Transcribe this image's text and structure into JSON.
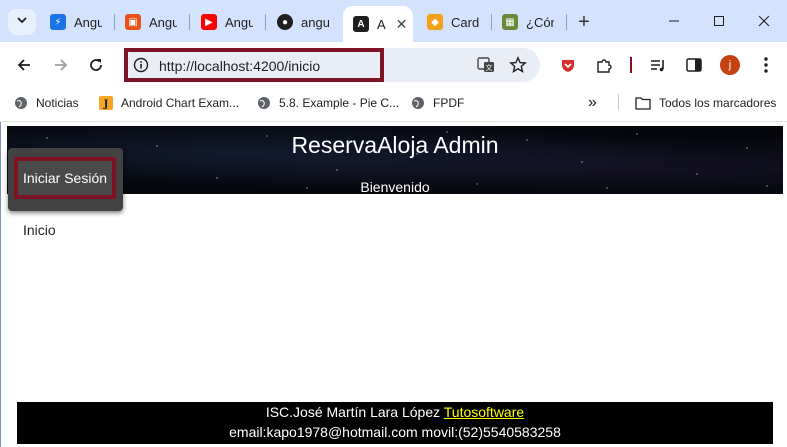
{
  "tabs": [
    {
      "label": "Angu",
      "icon": "lightning-icon",
      "color": "#1a73e8"
    },
    {
      "label": "Angu",
      "icon": "html-icon",
      "color": "#e8511a"
    },
    {
      "label": "Angu",
      "icon": "youtube-icon",
      "color": "#ff0000"
    },
    {
      "label": "angu",
      "icon": "github-icon",
      "color": "#1f1f1f"
    },
    {
      "label": "A",
      "icon": "angular-icon",
      "color": "#1f1f1f",
      "active": true
    },
    {
      "label": "Card",
      "icon": "shield-icon",
      "color": "#f4a11a"
    },
    {
      "label": "¿Cón",
      "icon": "image-icon",
      "color": "#6a8a3a"
    }
  ],
  "address": {
    "url": "http://localhost:4200/inicio"
  },
  "bookmarks": [
    {
      "label": "Noticias",
      "icon": "globe-icon"
    },
    {
      "label": "Android Chart Exam...",
      "icon": "java-icon"
    },
    {
      "label": "5.8. Example - Pie C...",
      "icon": "globe-icon"
    },
    {
      "label": "FPDF",
      "icon": "globe-icon"
    }
  ],
  "bookmarks_more": "»",
  "all_bookmarks": "Todos los marcadores",
  "profile": {
    "initial": "j"
  },
  "page": {
    "hero_title": "ReservaAloja Admin",
    "hero_subtitle": "Bienvenido",
    "login_button": "Iniciar Sesión",
    "content_text": "Inicio",
    "footer_author": "ISC.José Martín Lara López",
    "footer_link": "Tutosoftware",
    "footer_contact": "email:kapo1978@hotmail.com movil:(52)5540583258"
  },
  "colors": {
    "highlight": "#7e1326",
    "tabstrip": "#d3e3fd",
    "link": "#ffff00"
  }
}
